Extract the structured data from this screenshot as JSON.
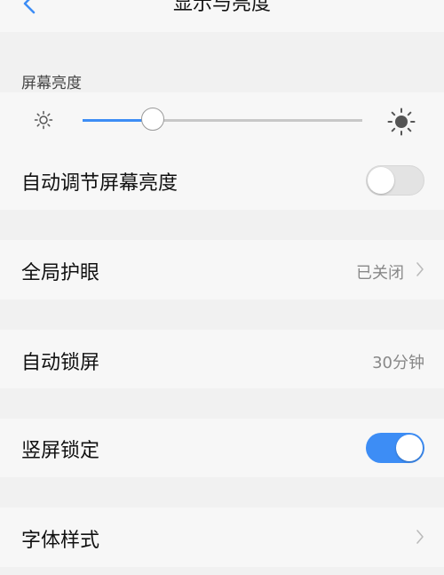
{
  "header": {
    "title": "显示与亮度",
    "back_icon": "chevron-left-icon"
  },
  "brightness": {
    "section_label": "屏幕亮度",
    "level": 0.25,
    "low_icon": "sun-small-icon",
    "high_icon": "sun-large-icon",
    "accent": "#3d8df5"
  },
  "rows": {
    "auto_brightness": {
      "label": "自动调节屏幕亮度",
      "enabled": false
    },
    "eye_protection": {
      "label": "全局护眼",
      "value": "已关闭"
    },
    "auto_lock": {
      "label": "自动锁屏",
      "value": "30分钟"
    },
    "portrait_lock": {
      "label": "竖屏锁定",
      "enabled": true
    },
    "font_style": {
      "label": "字体样式"
    }
  }
}
